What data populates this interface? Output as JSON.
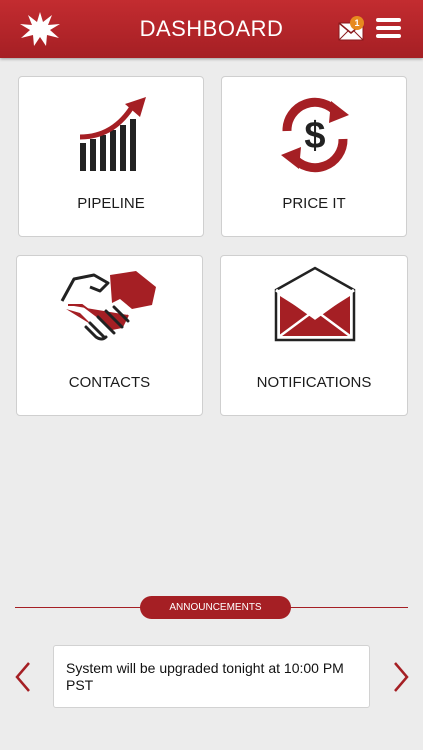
{
  "header": {
    "title": "DASHBOARD",
    "notification_count": "1",
    "logo_icon": "starburst-logo",
    "mail_icon": "envelope-icon",
    "menu_icon": "hamburger-menu-icon"
  },
  "tiles": [
    {
      "label": "PIPELINE",
      "icon": "growth-chart-icon"
    },
    {
      "label": "PRICE IT",
      "icon": "dollar-refresh-icon"
    },
    {
      "label": "CONTACTS",
      "icon": "handshake-icon"
    },
    {
      "label": "NOTIFICATIONS",
      "icon": "open-envelope-icon"
    }
  ],
  "announcements": {
    "heading": "ANNOUNCEMENTS",
    "message": "System will be upgraded tonight at 10:00 PM PST"
  },
  "colors": {
    "brand_red": "#a51f24",
    "header_red": "#c32c30",
    "badge_orange": "#e78a1f",
    "background": "#ececec"
  }
}
